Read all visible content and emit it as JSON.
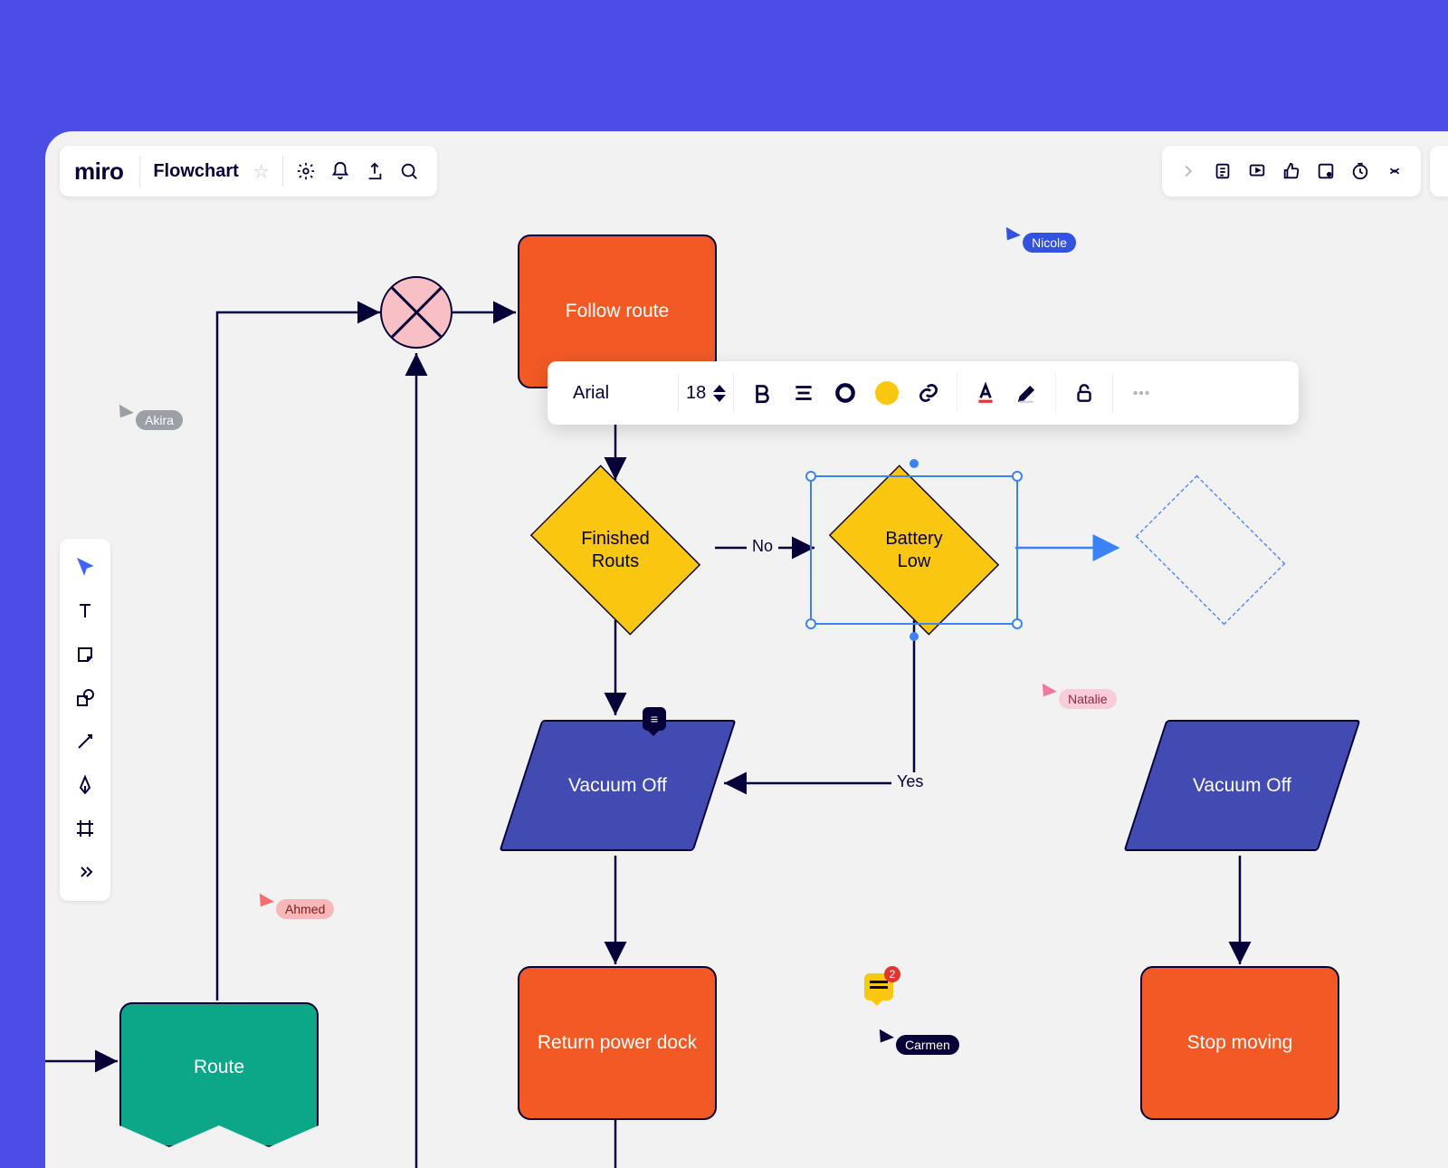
{
  "app": {
    "logo": "miro",
    "board_name": "Flowchart"
  },
  "left_toolbar": {
    "tools": [
      "select",
      "text",
      "sticky",
      "shape",
      "line",
      "pen",
      "frame",
      "more"
    ]
  },
  "float_toolbar": {
    "font": "Arial",
    "size": "18"
  },
  "shapes": {
    "route": "Route",
    "follow_route": "Follow route",
    "finished_routes": "Finished\nRouts",
    "battery_low": "Battery\nLow",
    "vacuum_off_1": "Vacuum Off",
    "vacuum_off_2": "Vacuum Off",
    "return_dock": "Return power dock",
    "stop_moving": "Stop moving"
  },
  "edges": {
    "no": "No",
    "yes": "Yes"
  },
  "cursors": {
    "akira": {
      "label": "Akira",
      "color": "#9aa0a6"
    },
    "ahmed": {
      "label": "Ahmed",
      "color": "#f66d6d"
    },
    "nicole": {
      "label": "Nicole",
      "color": "#3452e0"
    },
    "natalie": {
      "label": "Natalie",
      "color": "#f5a8bd"
    },
    "carmen": {
      "label": "Carmen",
      "color": "#050038"
    }
  },
  "comments": {
    "note_count": "2"
  }
}
